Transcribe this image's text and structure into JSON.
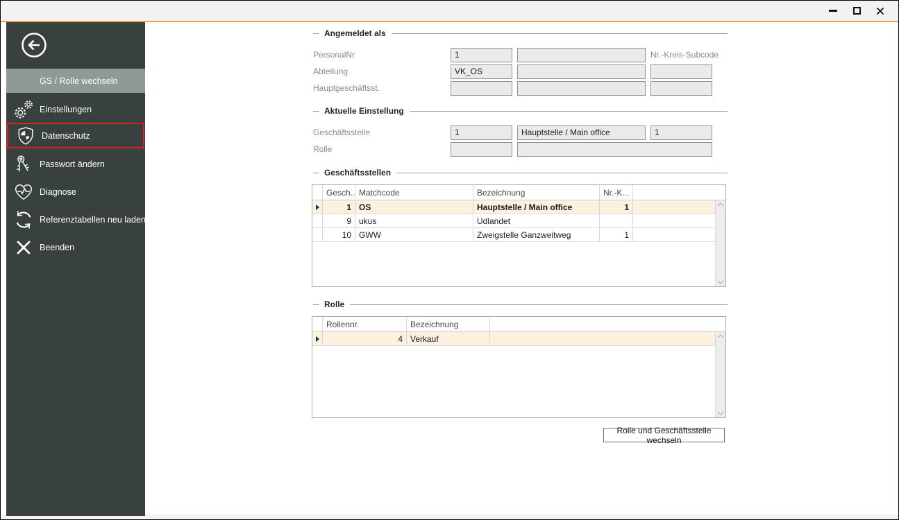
{
  "colors": {
    "accent_orange": "#efa23c",
    "sidebar_bg": "#394140",
    "sidebar_selected_bg": "#8e9a94",
    "highlight_red": "#e01e1e",
    "selected_row_bg": "#fcf0df"
  },
  "sidebar": {
    "items": [
      {
        "label": "GS / Rolle wechseln",
        "icon": "none",
        "state": "selected"
      },
      {
        "label": "Einstellungen",
        "icon": "gears"
      },
      {
        "label": "Datenschutz",
        "icon": "shield",
        "state": "highlighted-red"
      },
      {
        "label": "Passwort ändern",
        "icon": "keys"
      },
      {
        "label": "Diagnose",
        "icon": "heart-pulse"
      },
      {
        "label": "Referenztabellen neu laden",
        "icon": "refresh"
      },
      {
        "label": "Beenden",
        "icon": "x"
      }
    ]
  },
  "angemeldet": {
    "title": "Angemeldet als",
    "right_label": "Nr.-Kreis-Subcode",
    "rows": [
      {
        "label": "PersonalNr",
        "f1": "1",
        "f2": ""
      },
      {
        "label": "Abteilung",
        "f1": "VK_OS",
        "f2": "",
        "f3": ""
      },
      {
        "label": "Hauptgeschäftsst.",
        "f1": "",
        "f2": "",
        "f3": ""
      }
    ]
  },
  "aktuell": {
    "title": "Aktuelle Einstellung",
    "rows": [
      {
        "label": "Geschäftsstelle",
        "f1": "1",
        "f2": "Hauptstelle / Main office",
        "f3": "1"
      },
      {
        "label": "Rolle",
        "f1": "",
        "f2": ""
      }
    ]
  },
  "gs_table": {
    "title": "Geschäftsstellen",
    "columns": [
      "Gesch...",
      "Matchcode",
      "Bezeichnung",
      "Nr.-K..."
    ],
    "rows": [
      {
        "nr": "1",
        "matchcode": "OS",
        "bezeichnung": "Hauptstelle / Main office",
        "nrk": "1",
        "selected": true
      },
      {
        "nr": "9",
        "matchcode": "ukus",
        "bezeichnung": "Udlandet",
        "nrk": "",
        "selected": false
      },
      {
        "nr": "10",
        "matchcode": "GWW",
        "bezeichnung": "Zweigstelle Ganzweitweg",
        "nrk": "1",
        "selected": false
      }
    ]
  },
  "rolle_table": {
    "title": "Rolle",
    "columns": [
      "Rollennr.",
      "Bezeichnung"
    ],
    "rows": [
      {
        "nr": "4",
        "bezeichnung": "Verkauf",
        "selected": true
      }
    ]
  },
  "action_button": {
    "label": "Rolle und Geschäftsstelle wechseln"
  }
}
